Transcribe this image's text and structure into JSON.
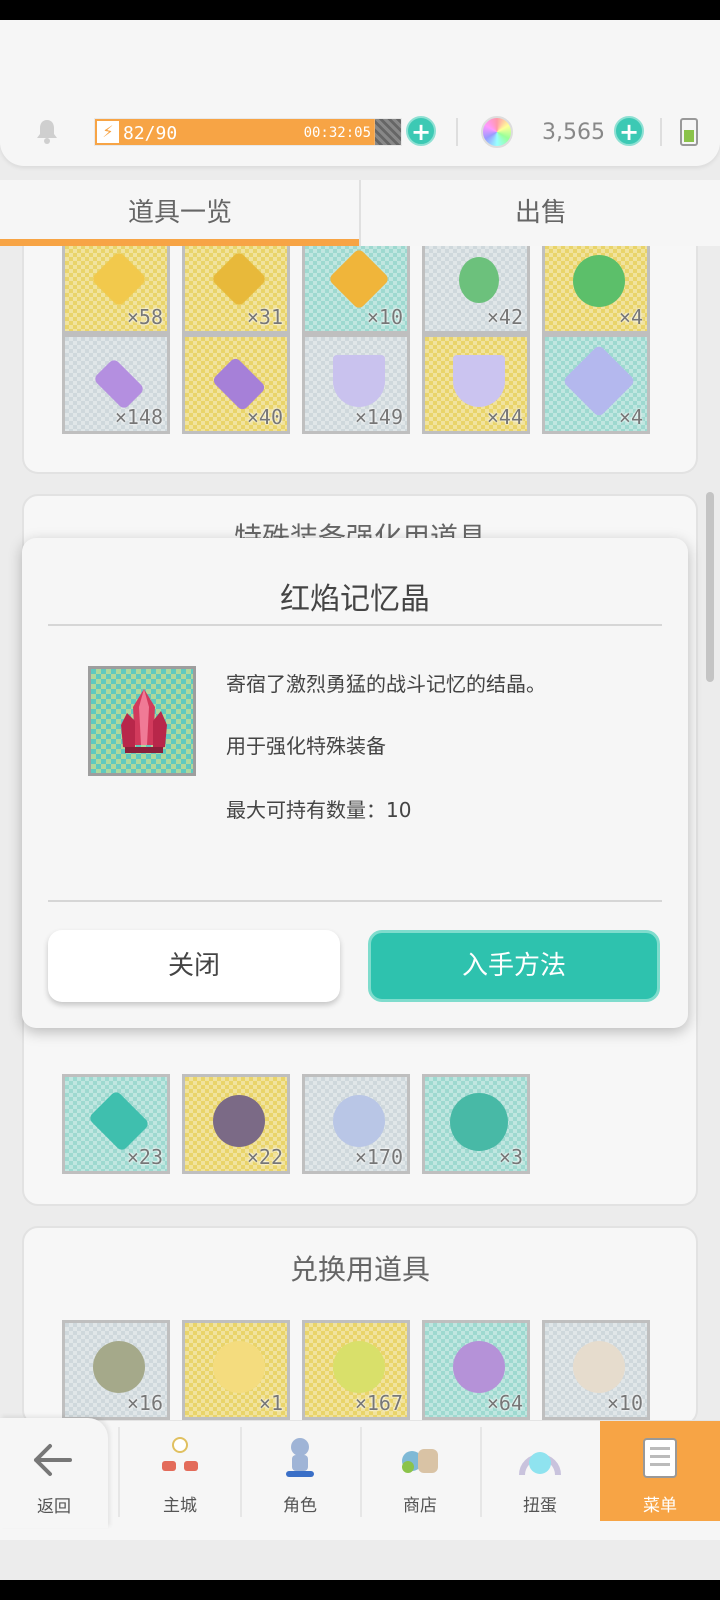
{
  "header": {
    "stamina": "82/90",
    "stamina_fraction": 0.911,
    "stamina_timer": "00:32:05",
    "gem_count": "3,565",
    "icons": [
      "bell-icon",
      "lightning-icon",
      "plus-icon",
      "gem-icon",
      "battery-icon"
    ]
  },
  "tabs": {
    "items": [
      {
        "label": "道具一览",
        "active": true
      },
      {
        "label": "出售",
        "active": false
      }
    ]
  },
  "panel_top": {
    "row1": [
      "×58",
      "×31",
      "×10",
      "×42",
      "×4"
    ],
    "row2": [
      "×148",
      "×40",
      "×149",
      "×44",
      "×4"
    ]
  },
  "panel_special": {
    "title": "特殊装备强化用道具",
    "row_last": [
      "×23",
      "×22",
      "×170",
      "×3"
    ]
  },
  "panel_exchange": {
    "title": "兑换用道具",
    "row1": [
      "×16",
      "×1",
      "×167",
      "×64",
      "×10"
    ]
  },
  "dialog": {
    "title": "红焰记忆晶",
    "desc1": "寄宿了激烈勇猛的战斗记忆的结晶。",
    "desc2": "用于强化特殊装备",
    "desc3": "最大可持有数量：10",
    "close_label": "关闭",
    "obtain_label": "入手方法"
  },
  "nav": {
    "back": "返回",
    "items": [
      {
        "label": "主城",
        "icon": "castle-icon"
      },
      {
        "label": "角色",
        "icon": "character-icon"
      },
      {
        "label": "商店",
        "icon": "shop-icon"
      },
      {
        "label": "扭蛋",
        "icon": "gacha-icon"
      },
      {
        "label": "菜单",
        "icon": "menu-icon",
        "active": true
      }
    ]
  },
  "colors": {
    "accent_orange": "#f7a445",
    "accent_teal": "#2ec2ae"
  }
}
